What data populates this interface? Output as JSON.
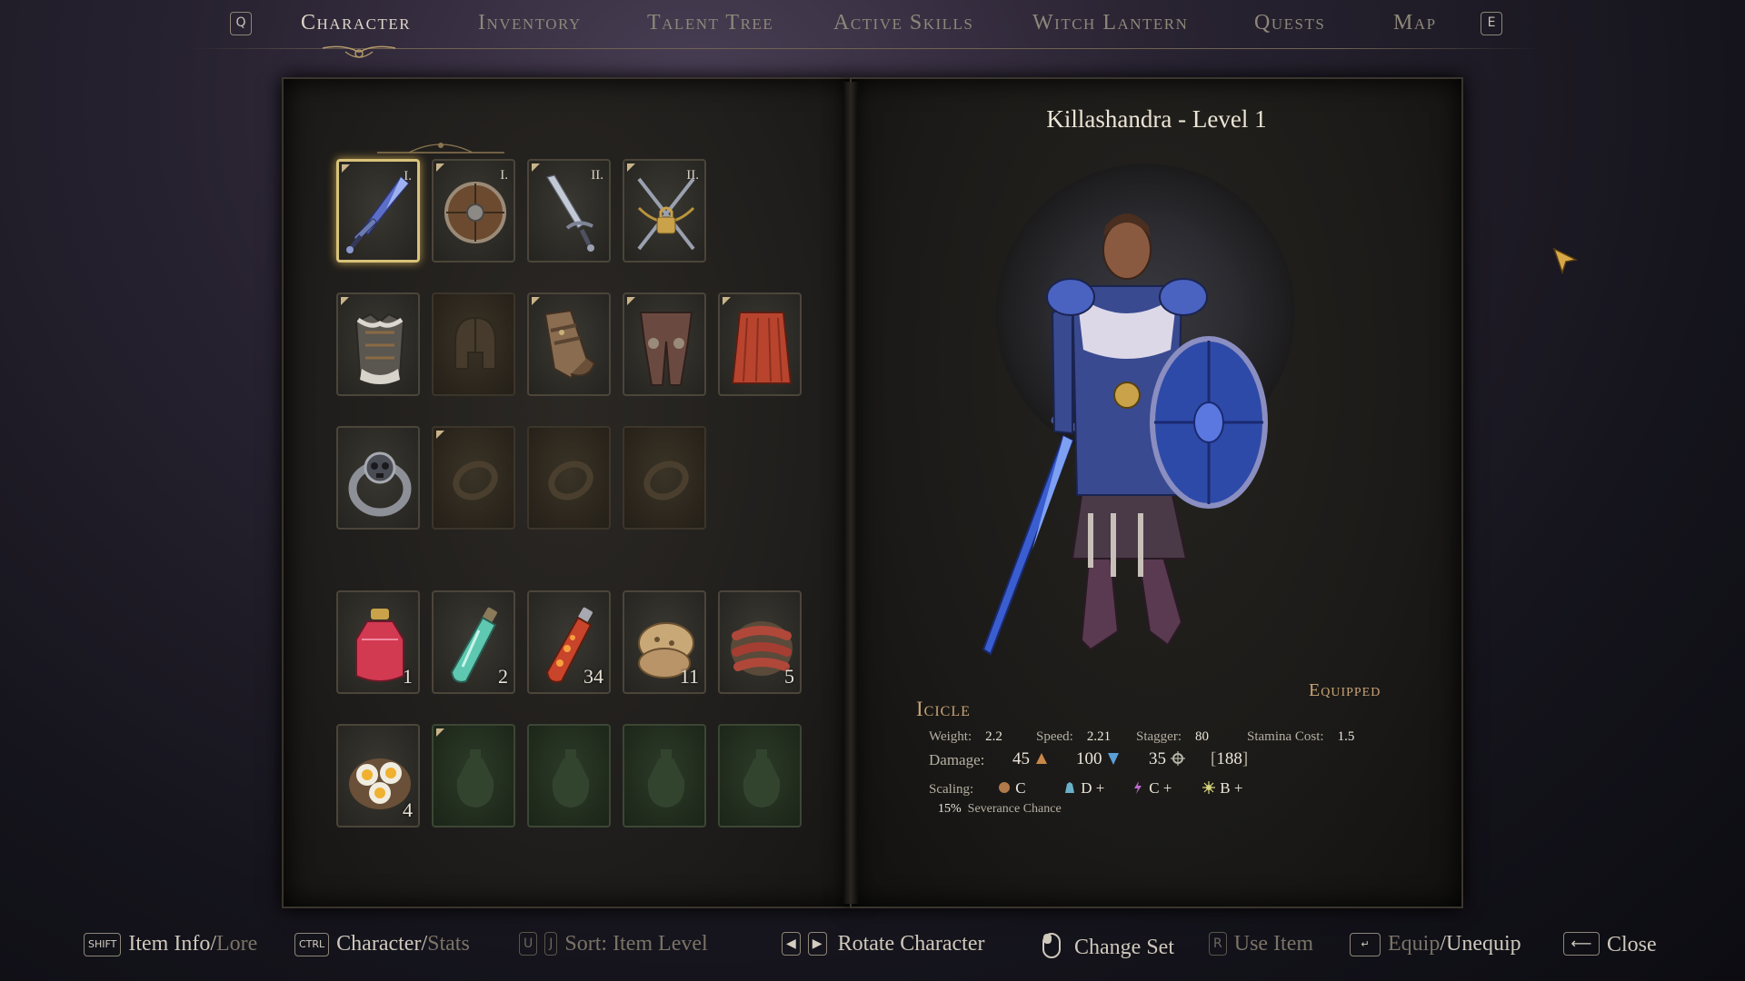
{
  "nav": {
    "left_key": "Q",
    "right_key": "E",
    "tabs": [
      {
        "label": "Character",
        "active": true
      },
      {
        "label": "Inventory",
        "active": false
      },
      {
        "label": "Talent Tree",
        "active": false
      },
      {
        "label": "Active Skills",
        "active": false
      },
      {
        "label": "Witch Lantern",
        "active": false
      },
      {
        "label": "Quests",
        "active": false
      },
      {
        "label": "Map",
        "active": false
      }
    ]
  },
  "equipment": {
    "weapons": [
      {
        "icon": "sword-icon",
        "roman": "I.",
        "selected": true
      },
      {
        "icon": "round-shield-icon",
        "roman": "I."
      },
      {
        "icon": "sword-icon",
        "roman": "II."
      },
      {
        "icon": "locked-crossed-swords-icon",
        "roman": "II."
      }
    ],
    "armor": [
      {
        "icon": "chest-armor-icon"
      },
      {
        "icon": "helmet-placeholder-icon",
        "empty": true
      },
      {
        "icon": "gauntlets-icon"
      },
      {
        "icon": "leg-armor-icon"
      },
      {
        "icon": "cape-icon"
      }
    ],
    "accessories": [
      {
        "icon": "skull-ring-icon"
      },
      {
        "icon": "ring-placeholder-icon",
        "empty": true
      },
      {
        "icon": "ring-placeholder-icon",
        "empty": true
      },
      {
        "icon": "ring-placeholder-icon",
        "empty": true
      }
    ],
    "consumables": [
      {
        "icon": "red-potion-icon",
        "count": "1"
      },
      {
        "icon": "green-vial-icon",
        "count": "2"
      },
      {
        "icon": "fire-vial-icon",
        "count": "34"
      },
      {
        "icon": "bread-icon",
        "count": "11"
      },
      {
        "icon": "sausage-icon",
        "count": "5"
      },
      {
        "icon": "eggs-icon",
        "count": "4"
      },
      {
        "icon": "flask-placeholder-icon",
        "empty": true
      },
      {
        "icon": "flask-placeholder-icon",
        "empty": true
      },
      {
        "icon": "flask-placeholder-icon",
        "empty": true
      },
      {
        "icon": "flask-placeholder-icon",
        "empty": true
      }
    ]
  },
  "character": {
    "title": "Killashandra - Level 1"
  },
  "item": {
    "name": "Icicle",
    "status": "Equipped",
    "weight_label": "Weight:",
    "weight": "2.2",
    "speed_label": "Speed:",
    "speed": "2.21",
    "stagger_label": "Stagger:",
    "stagger": "80",
    "stamina_label": "Stamina Cost:",
    "stamina": "1.5",
    "damage_label": "Damage:",
    "damage_physical": "45",
    "damage_frost": "100",
    "damage_holy": "35",
    "damage_total": "188",
    "scaling_label": "Scaling:",
    "scaling_str": "C",
    "scaling_dex": "D +",
    "scaling_magic": "C +",
    "scaling_faith": "B +",
    "severance_pct": "15%",
    "severance_label": "Severance Chance"
  },
  "footer": [
    {
      "keys": [
        "SHIFT"
      ],
      "label_a": "Item Info",
      "sep": "/",
      "label_b": "Lore"
    },
    {
      "keys": [
        "CTRL"
      ],
      "label_a": "Character",
      "sep": "/",
      "label_b": "Stats"
    },
    {
      "keys": [
        "U",
        "J"
      ],
      "label": "Sort: Item Level"
    },
    {
      "keys": [
        "◀",
        "▶"
      ],
      "label": "Rotate Character"
    },
    {
      "icon": "mouse-icon",
      "label": "Change Set"
    },
    {
      "keys": [
        "R"
      ],
      "label": "Use Item"
    },
    {
      "icon": "enter-key-icon",
      "label_a": "Equip",
      "sep": "/",
      "label_b": "Unequip"
    },
    {
      "icon": "backspace-key-icon",
      "label": "Close"
    }
  ],
  "colors": {
    "accent_gold": "#d8c27a",
    "item_name": "#c9a476",
    "frost": "#5aa0d8"
  }
}
